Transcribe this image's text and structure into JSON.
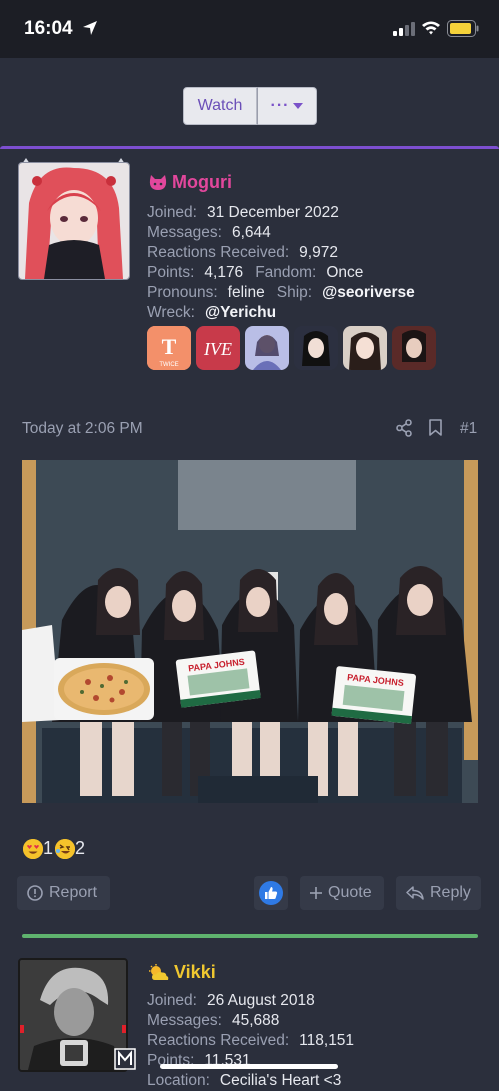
{
  "status_bar": {
    "time": "16:04"
  },
  "thread_actions": {
    "watch_label": "Watch",
    "more_label": "···"
  },
  "post1": {
    "username": "Moguri",
    "joined_label": "Joined:",
    "joined_value": "31 December 2022",
    "messages_label": "Messages:",
    "messages_value": "6,644",
    "reactions_label": "Reactions Received:",
    "reactions_value": "9,972",
    "points_label": "Points:",
    "points_value": "4,176",
    "fandom_label": "Fandom:",
    "fandom_value": "Once",
    "pronouns_label": "Pronouns:",
    "pronouns_value": "feline",
    "ship_label": "Ship:",
    "ship_value": "@seoriverse",
    "wreck_label": "Wreck:",
    "wreck_value": "@Yerichu",
    "badge_twice_text": "TWICE",
    "badge_ive_text": "IVE",
    "timestamp": "Today at 2:06 PM",
    "post_number": "#1",
    "reaction_count_love": "1",
    "reaction_count_haha": "2",
    "report_label": "Report",
    "quote_label": "Quote",
    "reply_label": "Reply",
    "photo_box_text_1": "PAPA JOHNS",
    "photo_box_text_2": "PAPA JOHNS"
  },
  "post2": {
    "username": "Vikki",
    "joined_label": "Joined:",
    "joined_value": "26 August 2018",
    "messages_label": "Messages:",
    "messages_value": "45,688",
    "reactions_label": "Reactions Received:",
    "reactions_value": "118,151",
    "points_label": "Points:",
    "points_value": "11,531",
    "location_label": "Location:",
    "location_value": "Cecilia's Heart <3"
  },
  "colors": {
    "accent_purple": "#7d4fd0",
    "username1": "#e2479c",
    "username2": "#f0c830",
    "post2_border": "#5fb36e",
    "like_blue": "#2f7ae5"
  }
}
